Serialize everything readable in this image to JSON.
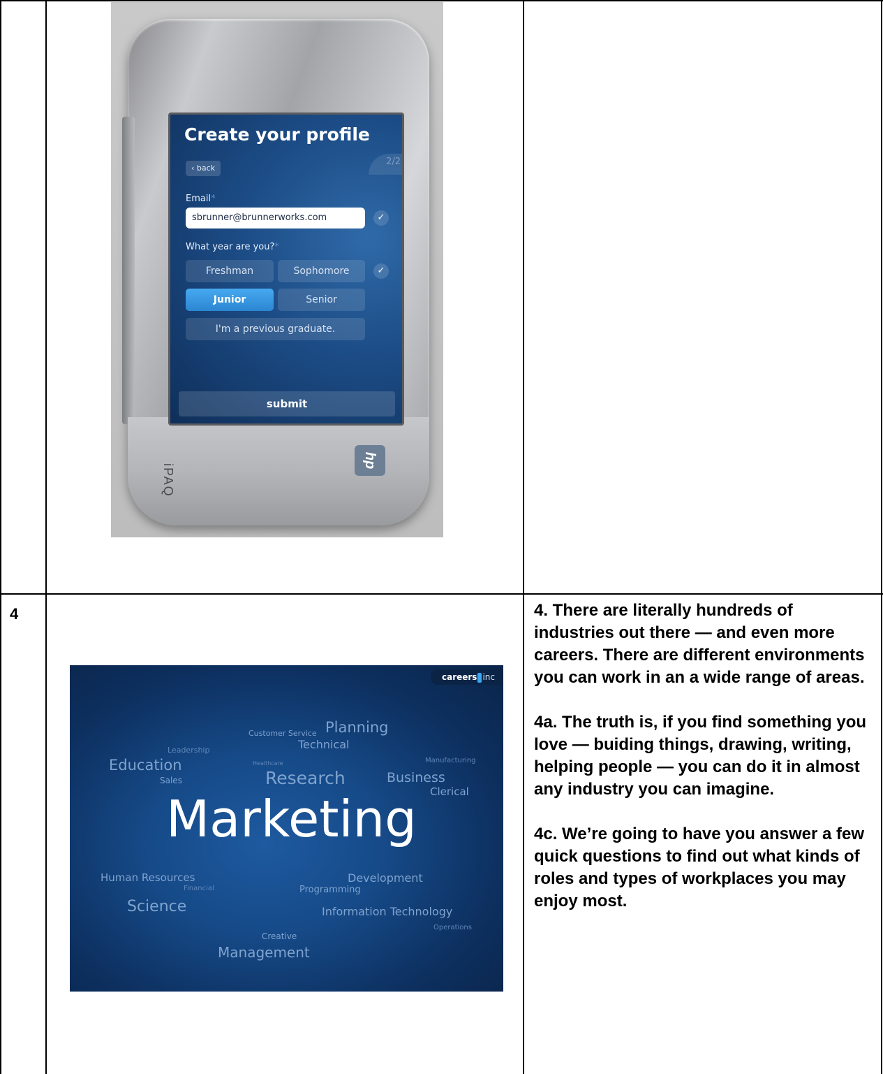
{
  "table": {
    "row_number": "4",
    "notes": [
      "4. There are literally hundreds of industries out there — and even more careers. There are different environments you can work in an a wide range of areas.",
      "4a. The truth is, if you find something you love — buiding things, drawing, writing, helping people — you can do it in almost any industry you can imagine.",
      "4c. We’re going to have you answer a few quick questions to find out what kinds of roles and types of workplaces you may enjoy most."
    ]
  },
  "device": {
    "brand_label": "iPAQ",
    "logo_text": "hp",
    "screen": {
      "title": "Create your profile",
      "step": "2/2",
      "back_label": "‹ back",
      "email_label": "Email",
      "required_mark": "*",
      "email_value": "sbrunner@brunnerworks.com",
      "check_glyph": "✓",
      "year_label": "What year are you?",
      "options": [
        "Freshman",
        "Sophomore",
        "Junior",
        "Senior",
        "I'm a previous graduate."
      ],
      "selected_option": "Junior",
      "submit_label": "submit"
    }
  },
  "word_cloud": {
    "logo_text": "careers",
    "logo_suffix": "inc",
    "words": [
      "Customer Service",
      "Planning",
      "Leadership",
      "Technical",
      "Education",
      "Healthcare",
      "Manufacturing",
      "Sales",
      "Research",
      "Business",
      "Clerical",
      "Marketing",
      "Human Resources",
      "Development",
      "Financial",
      "Programming",
      "Science",
      "Information Technology",
      "Operations",
      "Creative",
      "Management"
    ]
  },
  "colors": {
    "screen_bg": "#1c4c86",
    "selected_option": "#2c86d2",
    "cloud_bg": "#164a88"
  }
}
